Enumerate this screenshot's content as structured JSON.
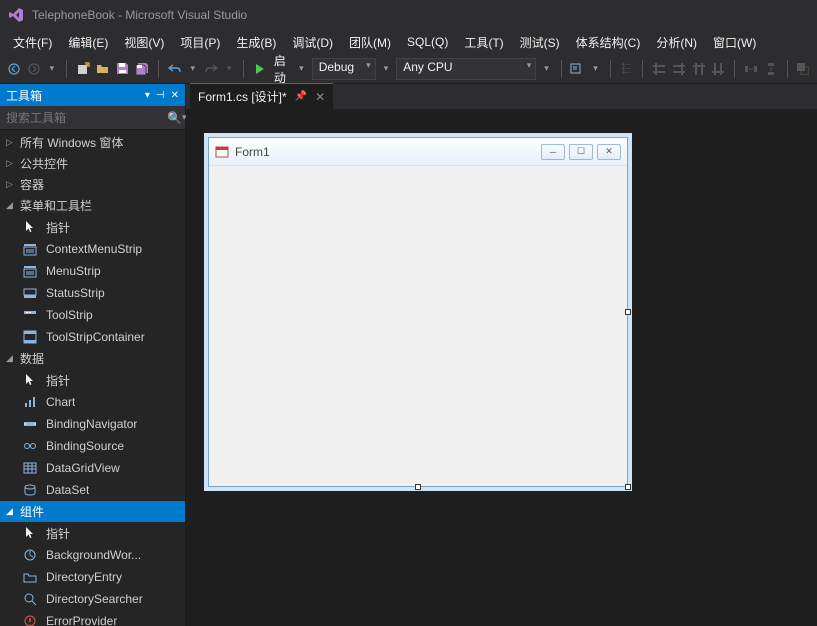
{
  "titlebar": {
    "title": "TelephoneBook - Microsoft Visual Studio"
  },
  "menubar": [
    "文件(F)",
    "编辑(E)",
    "视图(V)",
    "项目(P)",
    "生成(B)",
    "调试(D)",
    "团队(M)",
    "SQL(Q)",
    "工具(T)",
    "测试(S)",
    "体系结构(C)",
    "分析(N)",
    "窗口(W)"
  ],
  "toolbar": {
    "start_label": "启动",
    "config": "Debug",
    "platform": "Any CPU"
  },
  "toolbox": {
    "title": "工具箱",
    "search_placeholder": "搜索工具箱",
    "groups": [
      {
        "label": "所有 Windows 窗体",
        "expanded": false,
        "items": []
      },
      {
        "label": "公共控件",
        "expanded": false,
        "items": []
      },
      {
        "label": "容器",
        "expanded": false,
        "items": []
      },
      {
        "label": "菜单和工具栏",
        "expanded": true,
        "items": [
          {
            "icon": "pointer",
            "label": "指针"
          },
          {
            "icon": "menu",
            "label": "ContextMenuStrip"
          },
          {
            "icon": "menu",
            "label": "MenuStrip"
          },
          {
            "icon": "status",
            "label": "StatusStrip"
          },
          {
            "icon": "tool",
            "label": "ToolStrip"
          },
          {
            "icon": "container",
            "label": "ToolStripContainer"
          }
        ]
      },
      {
        "label": "数据",
        "expanded": true,
        "items": [
          {
            "icon": "pointer",
            "label": "指针"
          },
          {
            "icon": "chart",
            "label": "Chart"
          },
          {
            "icon": "nav",
            "label": "BindingNavigator"
          },
          {
            "icon": "bind",
            "label": "BindingSource"
          },
          {
            "icon": "grid",
            "label": "DataGridView"
          },
          {
            "icon": "dataset",
            "label": "DataSet"
          }
        ]
      },
      {
        "label": "组件",
        "expanded": true,
        "selected": true,
        "items": [
          {
            "icon": "pointer",
            "label": "指针"
          },
          {
            "icon": "bg",
            "label": "BackgroundWor..."
          },
          {
            "icon": "dir",
            "label": "DirectoryEntry"
          },
          {
            "icon": "search",
            "label": "DirectorySearcher"
          },
          {
            "icon": "err",
            "label": "ErrorProvider"
          }
        ]
      }
    ]
  },
  "editor": {
    "tab_label": "Form1.cs [设计]*",
    "form_title": "Form1"
  }
}
